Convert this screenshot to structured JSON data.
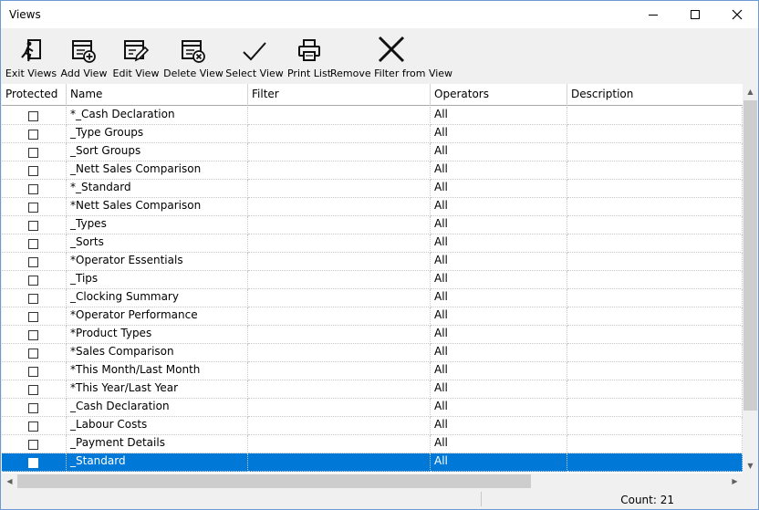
{
  "window": {
    "title": "Views"
  },
  "toolbar": {
    "exit_views": "Exit Views",
    "add_view": "Add View",
    "edit_view": "Edit View",
    "delete_view": "Delete View",
    "select_view": "Select View",
    "print_list": "Print List",
    "remove_filter": "Remove Filter from View"
  },
  "grid": {
    "columns": [
      "Protected",
      "Name",
      "Filter",
      "Operators",
      "Description"
    ],
    "rows": [
      {
        "name": "*_Cash Declaration",
        "filter": "",
        "operators": "All",
        "description": ""
      },
      {
        "name": "_Type Groups",
        "filter": "",
        "operators": "All",
        "description": ""
      },
      {
        "name": "_Sort Groups",
        "filter": "",
        "operators": "All",
        "description": ""
      },
      {
        "name": "_Nett Sales Comparison",
        "filter": "",
        "operators": "All",
        "description": ""
      },
      {
        "name": "*_Standard",
        "filter": "",
        "operators": "All",
        "description": ""
      },
      {
        "name": "*Nett Sales Comparison",
        "filter": "",
        "operators": "All",
        "description": ""
      },
      {
        "name": "_Types",
        "filter": "",
        "operators": "All",
        "description": ""
      },
      {
        "name": "_Sorts",
        "filter": "",
        "operators": "All",
        "description": ""
      },
      {
        "name": "*Operator Essentials",
        "filter": "",
        "operators": "All",
        "description": ""
      },
      {
        "name": "_Tips",
        "filter": "",
        "operators": "All",
        "description": ""
      },
      {
        "name": "_Clocking Summary",
        "filter": "",
        "operators": "All",
        "description": ""
      },
      {
        "name": "*Operator Performance",
        "filter": "",
        "operators": "All",
        "description": ""
      },
      {
        "name": "*Product Types",
        "filter": "",
        "operators": "All",
        "description": ""
      },
      {
        "name": "*Sales Comparison",
        "filter": "",
        "operators": "All",
        "description": ""
      },
      {
        "name": "*This Month/Last Month",
        "filter": "",
        "operators": "All",
        "description": ""
      },
      {
        "name": "*This Year/Last Year",
        "filter": "",
        "operators": "All",
        "description": ""
      },
      {
        "name": "_Cash Declaration",
        "filter": "",
        "operators": "All",
        "description": ""
      },
      {
        "name": "_Labour Costs",
        "filter": "",
        "operators": "All",
        "description": ""
      },
      {
        "name": "_Payment Details",
        "filter": "",
        "operators": "All",
        "description": ""
      },
      {
        "name": "_Standard",
        "filter": "",
        "operators": "All",
        "description": "",
        "selected": true
      }
    ]
  },
  "status": {
    "count": "Count: 21"
  },
  "colors": {
    "selection": "#0078d7",
    "window_border": "#6d9bd1"
  }
}
